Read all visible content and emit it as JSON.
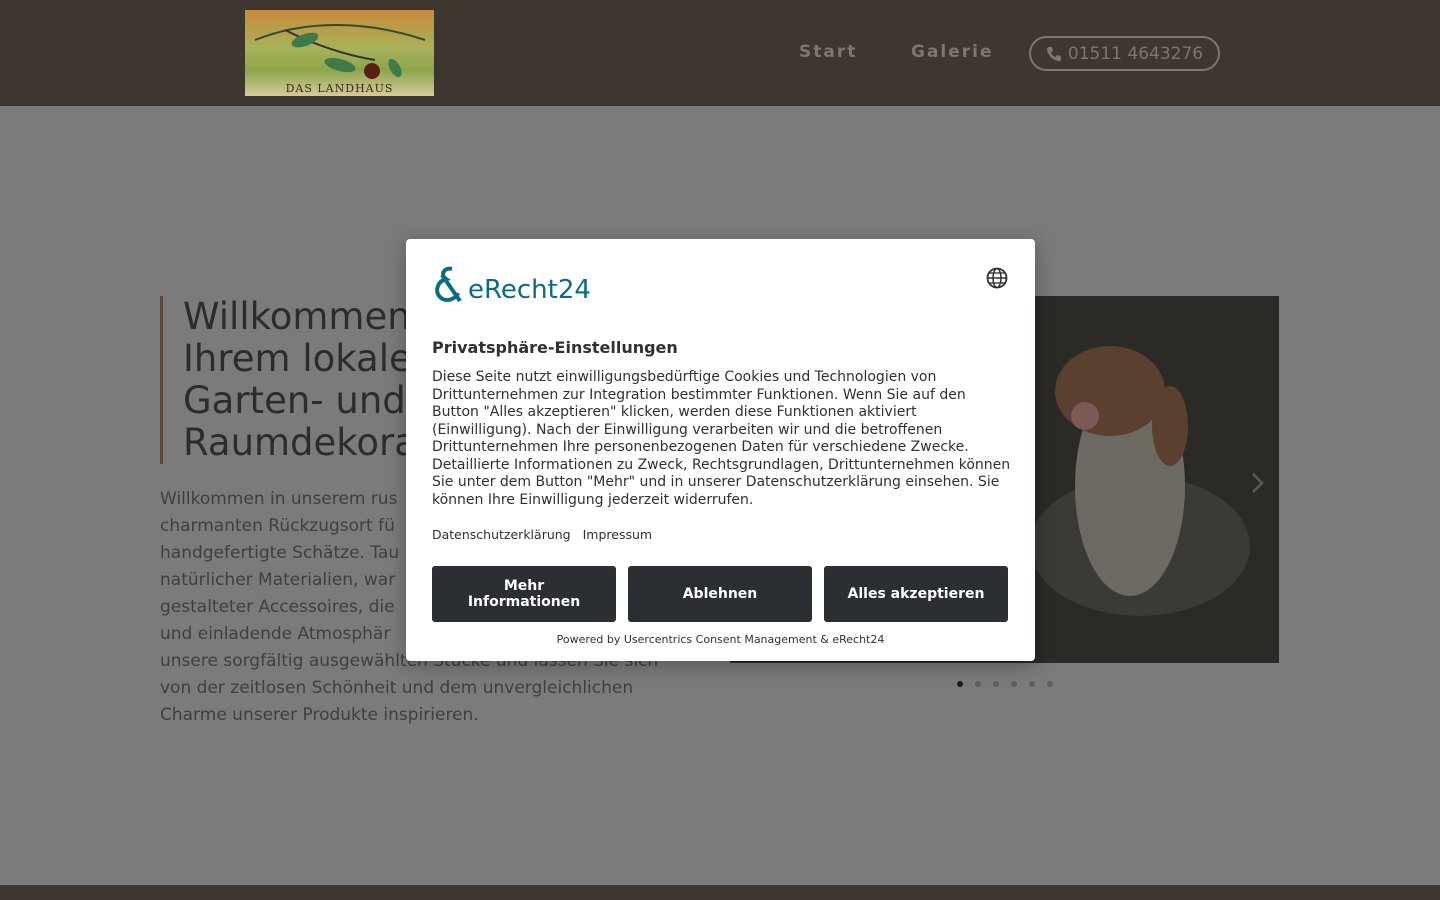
{
  "header": {
    "logo_text": "DAS LANDHAUS",
    "nav": [
      {
        "label": "Start"
      },
      {
        "label": "Galerie"
      }
    ],
    "phone": "01511 4643276"
  },
  "main": {
    "intro_title": "Willkommen\nIhrem lokalen\nGarten- und\nRaumdekorat",
    "intro_text": "Willkommen in unserem rus\ncharmanten Rückzugsort fü\nhandgefertigte Schätze. Tau\nnatürlicher Materialien, war\ngestalteter Accessoires, die\nund einladende Atmosphär\nunsere sorgfältig ausgewählten Stücke und lassen Sie sich\nvon der zeitlosen Schönheit und dem unvergleichlichen\nCharme unserer Produkte inspirieren.",
    "slider_dot_count": 6,
    "slider_active_dot": 1
  },
  "consent": {
    "brand": "eRecht24",
    "title": "Privatsphäre-Einstellungen",
    "body": "Diese Seite nutzt einwilligungsbedürftige Cookies und Technologien von Drittunternehmen zur Integration bestimmter Funktionen. Wenn Sie auf den Button \"Alles akzeptieren\" klicken, werden diese Funktionen aktiviert (Einwilligung). Nach der Einwilligung verarbeiten wir und die betroffenen Drittunternehmen Ihre personenbezogenen Daten für verschiedene Zwecke. Detaillierte Informationen zu Zweck, Rechtsgrundlagen, Drittunternehmen können Sie unter dem Button \"Mehr\" und in unserer Datenschutzerklärung einsehen. Sie können Ihre Einwilligung jederzeit widerrufen.",
    "links": [
      "Datenschutzerklärung",
      "Impressum"
    ],
    "buttons": {
      "more": "Mehr Informationen",
      "deny": "Ablehnen",
      "accept": "Alles akzeptieren"
    },
    "powered": "Powered by Usercentrics Consent Management & eRecht24"
  },
  "colors": {
    "header_bg": "#3d3730",
    "button_bg": "#2b2e33",
    "brand": "#0b6b86"
  }
}
